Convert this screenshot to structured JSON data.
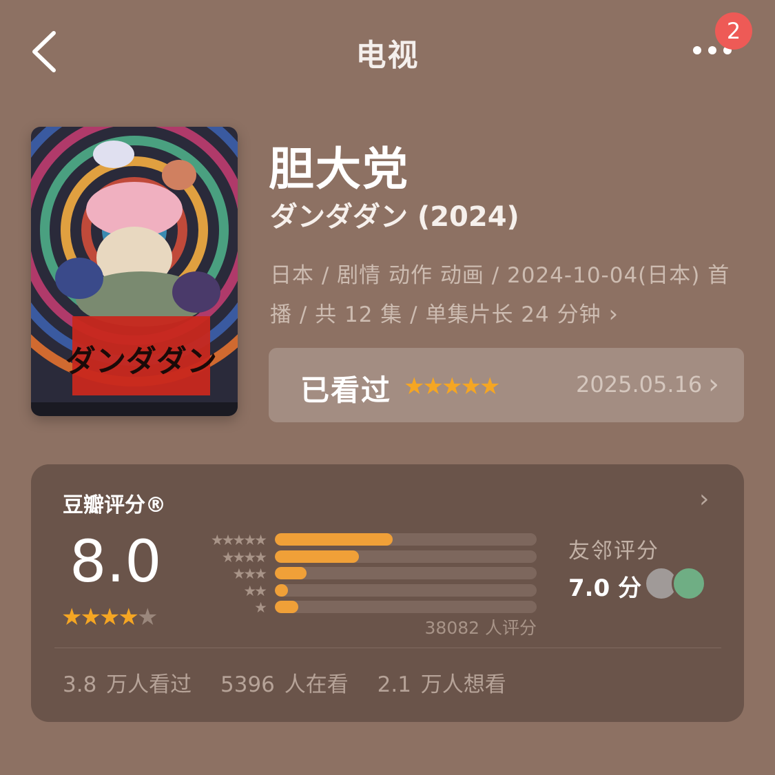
{
  "header": {
    "title": "电视",
    "back_icon": "chevron-left-icon",
    "more_icon": "more-dots-icon",
    "notification_count": "2"
  },
  "movie": {
    "title_cn": "胆大党",
    "title_orig": "ダンダダン (2024)",
    "meta": "日本 / 剧情 动作 动画 / 2024-10-04(日本) 首播 / 共 12 集 / 单集片长 24 分钟",
    "poster_logo_text": "ダンダダン"
  },
  "watched": {
    "label": "已看过",
    "stars": 5,
    "date": "2025.05.16"
  },
  "rating": {
    "title": "豆瓣评分®",
    "score": "8.0",
    "score_stars": 4,
    "distribution": [
      {
        "stars": 5,
        "fraction": 0.45
      },
      {
        "stars": 4,
        "fraction": 0.32
      },
      {
        "stars": 3,
        "fraction": 0.12
      },
      {
        "stars": 2,
        "fraction": 0.05
      },
      {
        "stars": 1,
        "fraction": 0.09
      }
    ],
    "count_text": "38082 人评分",
    "friend_label": "友邻评分",
    "friend_score": "7.0 分",
    "stats": [
      "3.8 万人看过",
      "5396 人在看",
      "2.1 万人想看"
    ]
  },
  "colors": {
    "background": "#8d7163",
    "card": "#6a544a",
    "accent": "#f5a623",
    "badge": "#ee5a56"
  }
}
